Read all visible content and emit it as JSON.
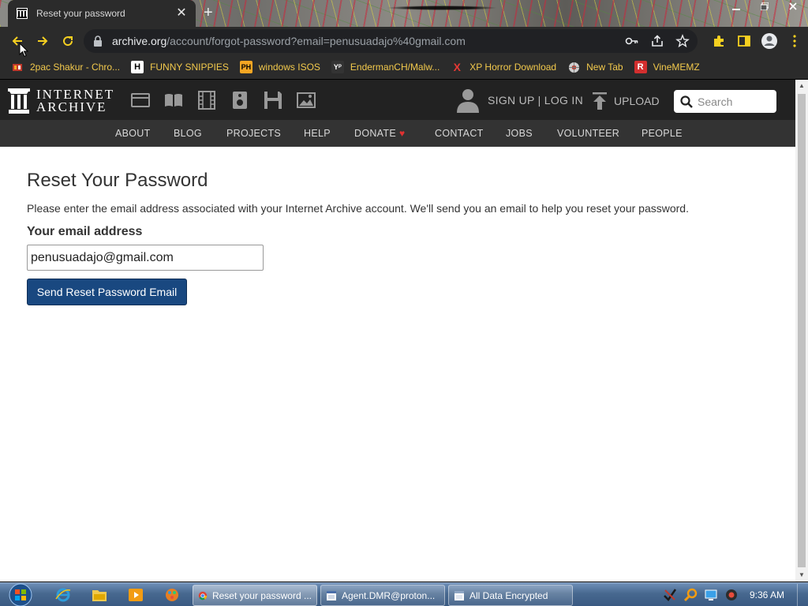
{
  "browser": {
    "tab": {
      "title": "Reset your password",
      "favicon": "archive-building-icon"
    },
    "url": {
      "host": "archive.org",
      "path": "/account/forgot-password?email=penusuadajo%40gmail.com"
    },
    "bookmarks": [
      {
        "label": "2pac Shakur - Chro...",
        "icon": "music-icon",
        "color": "#c0392b"
      },
      {
        "label": "FUNNY SNIPPIES",
        "icon": "H",
        "color": "#ffffff"
      },
      {
        "label": "windows ISOS",
        "icon": "PH",
        "color": "#f5a623"
      },
      {
        "label": "EndermanCH/Malw...",
        "icon": "YP",
        "color": "#333333"
      },
      {
        "label": "XP Horror Download",
        "icon": "X",
        "color": "#e53935"
      },
      {
        "label": "New Tab",
        "icon": "globe-icon",
        "color": "#999999"
      },
      {
        "label": "VineMEMZ",
        "icon": "R",
        "color": "#d32f2f"
      }
    ]
  },
  "ia": {
    "logo_line1": "INTERNET",
    "logo_line2": "ARCHIVE",
    "signup": "SIGN UP | LOG IN",
    "upload": "UPLOAD",
    "search_placeholder": "Search",
    "nav": [
      "ABOUT",
      "BLOG",
      "PROJECTS",
      "HELP",
      "DONATE",
      "CONTACT",
      "JOBS",
      "VOLUNTEER",
      "PEOPLE"
    ]
  },
  "page": {
    "title": "Reset Your Password",
    "description": "Please enter the email address associated with your Internet Archive account. We'll send you an email to help you reset your password.",
    "email_label": "Your email address",
    "email_value": "penusuadajo@gmail.com",
    "submit_label": "Send Reset Password Email"
  },
  "taskbar": {
    "tasks": [
      "Reset your password ...",
      "Agent.DMR@proton...",
      "All Data Encrypted"
    ],
    "clock": "9:36 AM"
  },
  "colors": {
    "accent": "#194880",
    "ia_dark": "#222222",
    "bookmark_text": "#f2c94c"
  }
}
